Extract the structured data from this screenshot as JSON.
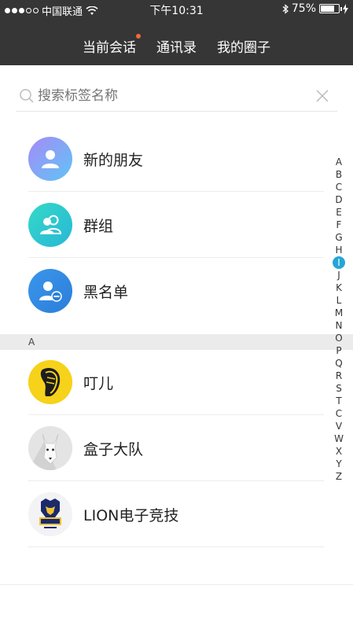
{
  "status_bar": {
    "carrier": "中国联通",
    "time": "下午10:31",
    "battery": "75%",
    "battery_level": 0.75
  },
  "header": {
    "tabs": [
      {
        "label": "当前会话",
        "badge": true
      },
      {
        "label": "通讯录",
        "badge": false
      },
      {
        "label": "我的圈子",
        "badge": false
      }
    ]
  },
  "search": {
    "placeholder": "搜索标签名称"
  },
  "fixed_items": [
    {
      "label": "新的朋友",
      "icon": "person-icon",
      "color": "#8e8ef6"
    },
    {
      "label": "群组",
      "icon": "group-icon",
      "color": "#2fd2c5"
    },
    {
      "label": "黑名单",
      "icon": "blocked-person-icon",
      "color": "#3a8fe8"
    }
  ],
  "section": {
    "letter": "A"
  },
  "contacts": [
    {
      "label": "叮儿",
      "avatar": "yellow-face-avatar"
    },
    {
      "label": "盒子大队",
      "avatar": "white-dog-avatar"
    },
    {
      "label": "LION电子竞技",
      "avatar": "lion-logo-avatar"
    }
  ],
  "index_letters": [
    "A",
    "B",
    "C",
    "D",
    "E",
    "F",
    "G",
    "H",
    "I",
    "J",
    "K",
    "L",
    "M",
    "N",
    "O",
    "P",
    "Q",
    "R",
    "S",
    "T",
    "C",
    "V",
    "W",
    "X",
    "Y",
    "Z"
  ],
  "index_active": "I"
}
